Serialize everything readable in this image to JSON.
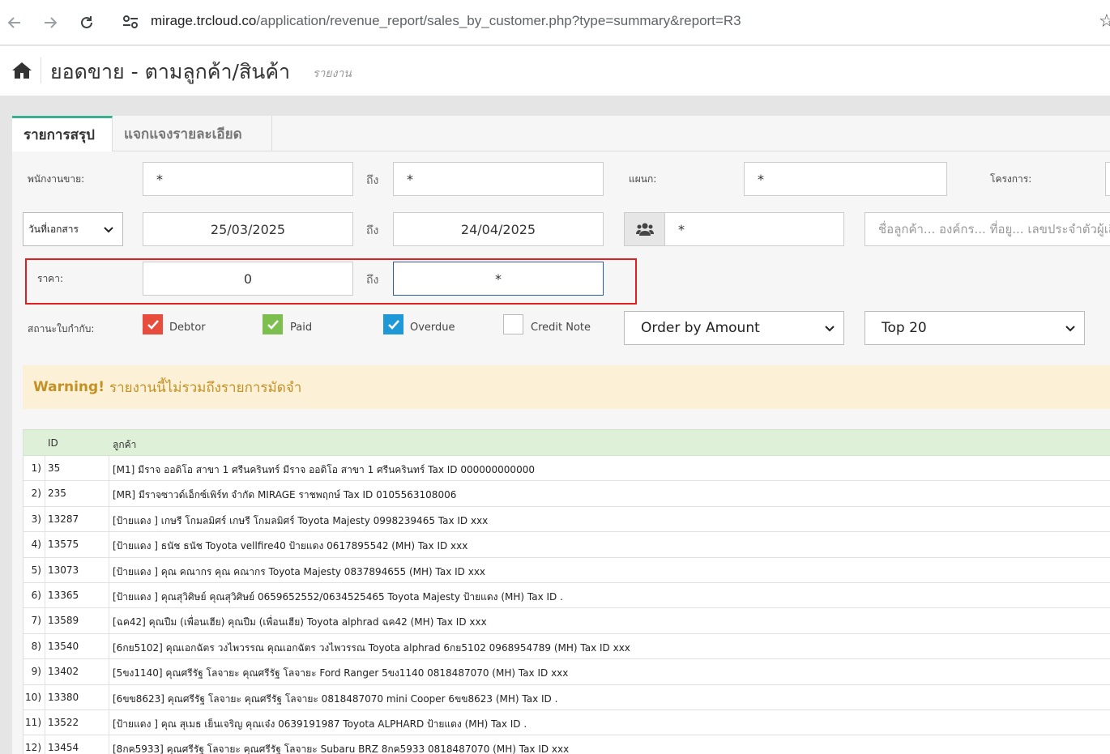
{
  "browser": {
    "url_host": "mirage.trcloud.co",
    "url_path": "/application/revenue_report/sales_by_customer.php?type=summary&report=R3"
  },
  "header": {
    "title": "ยอดขาย - ตามลูกค้า/สินค้า",
    "subtitle": "รายงาน"
  },
  "tabs": [
    {
      "label": "รายการสรุป",
      "active": true
    },
    {
      "label": "แจกแจงรายละเอียด",
      "active": false
    }
  ],
  "filters": {
    "salesperson_label": "พนักงานขาย:",
    "salesperson_from": "*",
    "to_label": "ถึง",
    "salesperson_to": "*",
    "department_label": "แผนก:",
    "department_value": "*",
    "project_label": "โครงการ:",
    "date_type": "วันที่เอกสาร",
    "date_from": "25/03/2025",
    "date_to": "24/04/2025",
    "group_value": "*",
    "customer_placeholder": "ชื่อลูกค้า... องค์กร... ที่อยู... เลขประจำตัวผู้เสียภาษี",
    "price_label": "ราคา:",
    "price_from": "0",
    "price_to": "*",
    "status_label": "สถานะใบกำกับ:",
    "statuses": [
      {
        "label": "Debtor",
        "checked": true,
        "color": "#e74c3c"
      },
      {
        "label": "Paid",
        "checked": true,
        "color": "#7cbf4e"
      },
      {
        "label": "Overdue",
        "checked": true,
        "color": "#1e98d7"
      },
      {
        "label": "Credit Note",
        "checked": false,
        "color": "#ffffff"
      }
    ],
    "order_by": "Order by Amount",
    "top_n": "Top 20"
  },
  "warning": {
    "strong": "Warning!",
    "text": "รายงานนี้ไม่รวมถึงรายการมัดจำ"
  },
  "table": {
    "headers": {
      "id": "ID",
      "customer": "ลูกค้า"
    },
    "rows": [
      {
        "num": "1)",
        "id": "35",
        "customer": "[M1] มีราจ ออดิโอ สาขา 1 ศรีนครินทร์ มีราจ ออดิโอ สาขา 1 ศรีนครินทร์ Tax ID 000000000000"
      },
      {
        "num": "2)",
        "id": "235",
        "customer": "[MR] มีราจซาวด์เอ็กซ์เพิร์ท จำกัด MIRAGE ราชพฤกษ์ Tax ID 0105563108006"
      },
      {
        "num": "3)",
        "id": "13287",
        "customer": "[ป้ายแดง ] เกษรี โกมลมิศร์ เกษรี โกมลมิศร์ Toyota Majesty 0998239465 Tax ID xxx"
      },
      {
        "num": "4)",
        "id": "13575",
        "customer": "[ป้ายแดง ] ธนัช ธนัช Toyota vellfire40 ป้ายแดง 0617895542 (MH) Tax ID xxx"
      },
      {
        "num": "5)",
        "id": "13073",
        "customer": "[ป้ายแดง ] คุณ คณากร คุณ คณากร Toyota Majesty 0837894655 (MH) Tax ID xxx"
      },
      {
        "num": "6)",
        "id": "13365",
        "customer": "[ป้ายแดง ] คุณสุวิศิษย์ คุณสุวิศิษย์ 0659652552/0634525465 Toyota Majesty ป้ายแดง (MH) Tax ID ."
      },
      {
        "num": "7)",
        "id": "13589",
        "customer": "[ฉค42] คุณปืม (เพื่อนเฮีย) คุณปืม (เพื่อนเฮีย) Toyota alphrad ฉค42 (MH) Tax ID xxx"
      },
      {
        "num": "8)",
        "id": "13540",
        "customer": "[6กย5102] คุณเอกฉัตร วงไพวรรณ คุณเอกฉัตร วงไพวรรณ Toyota alphrad 6กย5102 0968954789 (MH) Tax ID xxx"
      },
      {
        "num": "9)",
        "id": "13402",
        "customer": "[5ขง1140] คุณศรีรัฐ โลจายะ คุณศรีรัฐ โลจายะ Ford Ranger 5ขง1140 0818487070 (MH) Tax ID xxx"
      },
      {
        "num": "10)",
        "id": "13380",
        "customer": "[6ขข8623] คุณศรีรัฐ โลจายะ คุณศรีรัฐ โลจายะ 0818487070 mini Cooper 6ขข8623 (MH) Tax ID ."
      },
      {
        "num": "11)",
        "id": "13522",
        "customer": "[ป้ายแดง ] คุณ สุเมธ เย็นเจริญ คุณเจ๋ง 0639191987 Toyota ALPHARD ป้ายแดง (MH) Tax ID ."
      },
      {
        "num": "12)",
        "id": "13454",
        "customer": "[8กค5933] คุณศรีรัฐ โลจายะ คุณศรีรัฐ โลจายะ Subaru BRZ 8กค5933 0818487070 (MH) Tax ID xxx"
      }
    ]
  }
}
